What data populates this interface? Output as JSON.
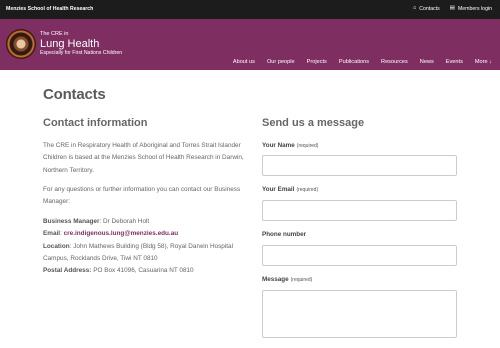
{
  "topbar": {
    "org_name": "Menzies School of Health Research",
    "contacts_label": "Contacts",
    "members_label": "Members login",
    "contacts_icon": "home-icon",
    "members_icon": "id-card-icon"
  },
  "header": {
    "brand_small": "The CRE in",
    "brand_big": "Lung Health",
    "brand_sub": "Especially for First Nations Children",
    "bg_color": "#7f2e62"
  },
  "nav": {
    "items": [
      "About us",
      "Our people",
      "Projects",
      "Publications",
      "Resources",
      "News",
      "Events",
      "More ↓"
    ]
  },
  "page": {
    "title": "Contacts"
  },
  "contact_info": {
    "heading": "Contact information",
    "para1": "The CRE in Respiratory Health of Aboriginal and Torres Strait Islander Children is based at the Menzies School of Health Research in Darwin, Northern Territory.",
    "para2": "For any questions or further information you can contact our Business Manager:",
    "manager_label": "Business Manager",
    "manager_value": ": Dr Deborah Holt",
    "email_label": "Email",
    "email_value": "cre.indigenous.lung@menzies.edu.au",
    "location_label": "Location",
    "location_value": ": John Mathews Building (Bldg 58), Royal Darwin Hospital Campus, Rocklands Drive, Tiwi NT 0810",
    "postal_label": "Postal Address:",
    "postal_value": " PO Box 41096, Casuarina NT 0810"
  },
  "form": {
    "heading": "Send us a message",
    "name_label": "Your Name",
    "email_label": "Your Email",
    "phone_label": "Phone number",
    "message_label": "Message",
    "required_text": "(required)"
  }
}
